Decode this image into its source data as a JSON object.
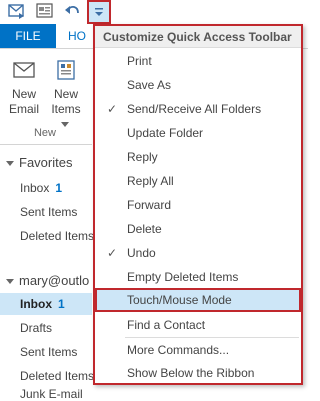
{
  "qat": {
    "icons": [
      "send-receive-icon",
      "folder-icon",
      "undo-icon",
      "customize-dropdown-icon"
    ]
  },
  "ribbon": {
    "file_tab": "FILE",
    "home_tab": "HO",
    "new_email": [
      "New",
      "Email"
    ],
    "new_items": [
      "New",
      "Items"
    ],
    "group_label": "New"
  },
  "nav": {
    "favorites_header": "Favorites",
    "favorites": [
      {
        "label": "Inbox",
        "count": "1"
      },
      {
        "label": "Sent Items"
      },
      {
        "label": "Deleted Items"
      }
    ],
    "account_header": "mary@outlo",
    "account_items": [
      {
        "label": "Inbox",
        "count": "1"
      },
      {
        "label": "Drafts"
      },
      {
        "label": "Sent Items"
      },
      {
        "label": "Deleted Items"
      },
      {
        "label": "Junk E-mail"
      }
    ]
  },
  "menu": {
    "header": "Customize Quick Access Toolbar",
    "items": [
      {
        "label": "Print",
        "checked": false
      },
      {
        "label": "Save As",
        "checked": false
      },
      {
        "label": "Send/Receive All Folders",
        "checked": true
      },
      {
        "label": "Update Folder",
        "checked": false
      },
      {
        "label": "Reply",
        "checked": false
      },
      {
        "label": "Reply All",
        "checked": false
      },
      {
        "label": "Forward",
        "checked": false
      },
      {
        "label": "Delete",
        "checked": false
      },
      {
        "label": "Undo",
        "checked": true
      },
      {
        "label": "Empty Deleted Items",
        "checked": false
      },
      {
        "label": "Touch/Mouse Mode",
        "checked": false,
        "highlighted": true
      },
      {
        "label": "Find a Contact",
        "checked": false
      },
      {
        "label": "More Commands...",
        "checked": false
      },
      {
        "label": "Show Below the Ribbon",
        "checked": false
      }
    ],
    "check_glyph": "✓"
  },
  "colors": {
    "accent": "#0072c6",
    "highlight_border": "#c0282d",
    "hover_fill": "#cde6f7"
  }
}
